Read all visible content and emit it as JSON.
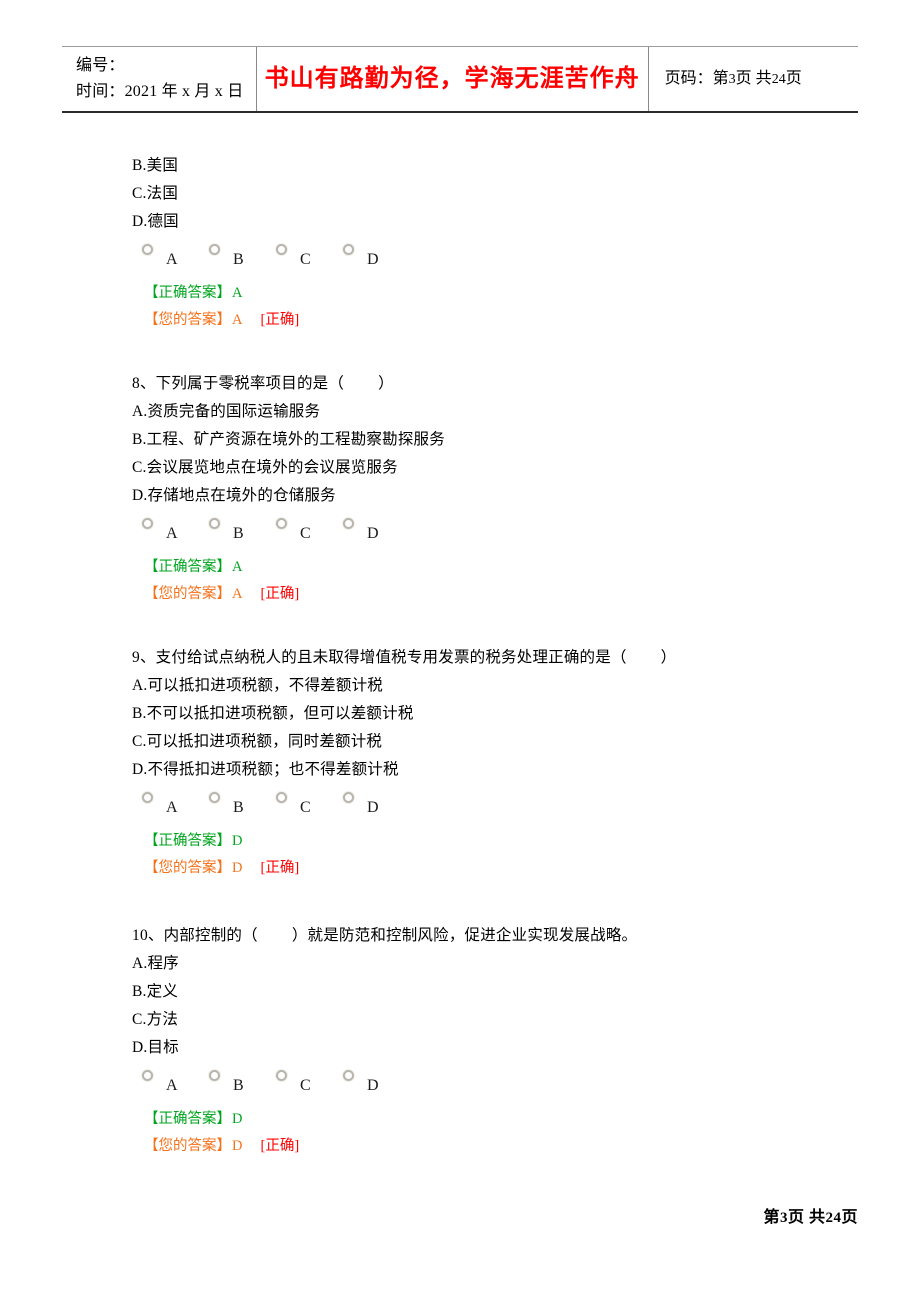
{
  "header": {
    "left": {
      "code_label": "编号：",
      "time_label": "时间：2021 年 x 月 x 日"
    },
    "slogan": "书山有路勤为径，学海无涯苦作舟",
    "right": {
      "page_prefix": "页码：第",
      "page_current": "3",
      "page_mid": "页 共",
      "page_total": "24",
      "page_suffix": "页"
    }
  },
  "labels": {
    "correct_answer": "【正确答案】",
    "your_answer": "【您的答案】",
    "judge_correct": "[正确]",
    "paren_open": "（",
    "paren_close": "）",
    "radio_options": [
      "A",
      "B",
      "C",
      "D"
    ]
  },
  "questions": [
    {
      "id": "q7-continued",
      "stem": "",
      "options": [
        "B.美国",
        "C.法国",
        "D.德国"
      ],
      "correct_answer": "A",
      "your_answer": "A",
      "judge": "[正确]"
    },
    {
      "id": "q8",
      "stem_prefix": "8、下列属于零税率项目的是",
      "stem_suffix": "",
      "options": [
        "A.资质完备的国际运输服务",
        "B.工程、矿产资源在境外的工程勘察勘探服务",
        "C.会议展览地点在境外的会议展览服务",
        "D.存储地点在境外的仓储服务"
      ],
      "correct_answer": "A",
      "your_answer": "A",
      "judge": "[正确]"
    },
    {
      "id": "q9",
      "stem_prefix": "9、支付给试点纳税人的且未取得增值税专用发票的税务处理正确的是",
      "stem_suffix": "",
      "options": [
        "A.可以抵扣进项税额，不得差额计税",
        "B.不可以抵扣进项税额，但可以差额计税",
        "C.可以抵扣进项税额，同时差额计税",
        "D.不得抵扣进项税额；也不得差额计税"
      ],
      "correct_answer": "D",
      "your_answer": "D",
      "judge": "[正确]"
    },
    {
      "id": "q10",
      "stem_prefix": "10、内部控制的",
      "stem_suffix": "就是防范和控制风险，促进企业实现发展战略。",
      "options": [
        "A.程序",
        "B.定义",
        "C.方法",
        "D.目标"
      ],
      "correct_answer": "D",
      "your_answer": "D",
      "judge": "[正确]"
    }
  ],
  "footer": {
    "prefix": "第",
    "current": "3",
    "mid": "页 共",
    "total": "24",
    "suffix": "页"
  }
}
